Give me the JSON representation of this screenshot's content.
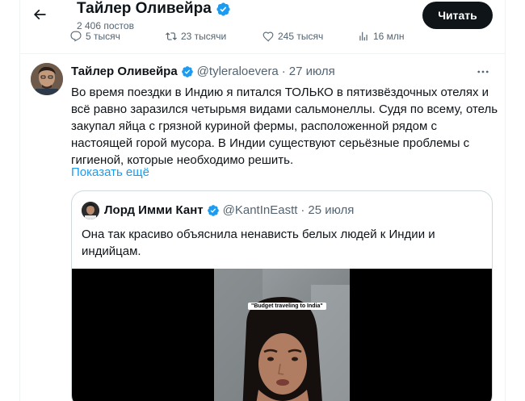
{
  "header": {
    "title": "Тайлер Оливейра",
    "posts_count": "2 406 постов",
    "read_button": "Читать"
  },
  "prev_stats": {
    "replies": "5 тысяч",
    "reposts": "23 тысячи",
    "likes": "245 тысяч",
    "views": "16 млн"
  },
  "tweet": {
    "name": "Тайлер Оливейра",
    "handle": "@tyleraloevera",
    "separator": "·",
    "date": "27 июля",
    "lines": [
      "Во время поездки в Индию я питался ТОЛЬКО в пятизвёздочных отелях и",
      "всё равно заразился четырьмя видами сальмонеллы. Судя по всему, отель",
      "закупал яйца с грязной куриной фермы, расположенной рядом с",
      "настоящей горой мусора. В Индии существуют серьёзные проблемы с",
      "гигиеной, которые необходимо решить."
    ],
    "show_more": "Показать ещё"
  },
  "quote": {
    "name": "Лорд Имми Кант",
    "handle": "@KantInEastt",
    "separator": "·",
    "date": "25 июля",
    "lines": [
      "Она так красиво объяснила ненависть белых людей к Индии и",
      "индийцам."
    ],
    "video_caption": "\"Budget traveling to India\""
  },
  "colors": {
    "verified": "#1d9bf0",
    "link": "#1d9bf0",
    "secondary_text": "#536471",
    "primary_text": "#0f1419",
    "button_bg": "#0f1419"
  },
  "icons": {
    "back": "arrow-left-icon",
    "verified": "verified-badge-icon",
    "more": "more-dots-icon",
    "reply": "reply-icon",
    "repost": "repost-icon",
    "like": "heart-icon",
    "views": "views-chart-icon"
  }
}
